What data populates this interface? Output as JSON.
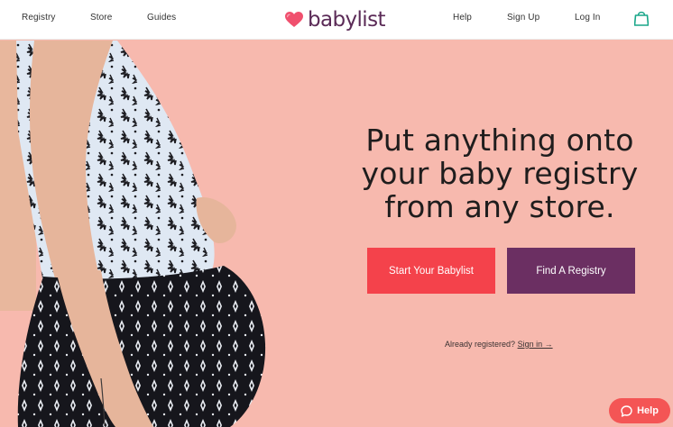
{
  "nav": {
    "left_links": [
      {
        "label": "Registry"
      },
      {
        "label": "Store"
      },
      {
        "label": "Guides"
      }
    ],
    "logo_text": "babylist",
    "right_links": [
      {
        "label": "Help"
      },
      {
        "label": "Sign Up"
      },
      {
        "label": "Log In"
      }
    ],
    "cart_icon": "shopping-bag-icon",
    "logo_icon": "heart-icon"
  },
  "hero": {
    "headline_lines": [
      "Put anything onto",
      "your baby registry",
      "from any store."
    ],
    "primary_button": "Start Your Babylist",
    "secondary_button": "Find A Registry",
    "already_text": "Already registered?",
    "signin_link": "Sign in →"
  },
  "help_widget": {
    "label": "Help",
    "icon": "chat-bubble-icon"
  },
  "colors": {
    "background": "#f7b9ae",
    "primary_button": "#f4424b",
    "secondary_button": "#6b2f62",
    "logo_heart": "#f0506e",
    "logo_text": "#5b2b57",
    "cart": "#18a689",
    "help": "#f45555"
  }
}
